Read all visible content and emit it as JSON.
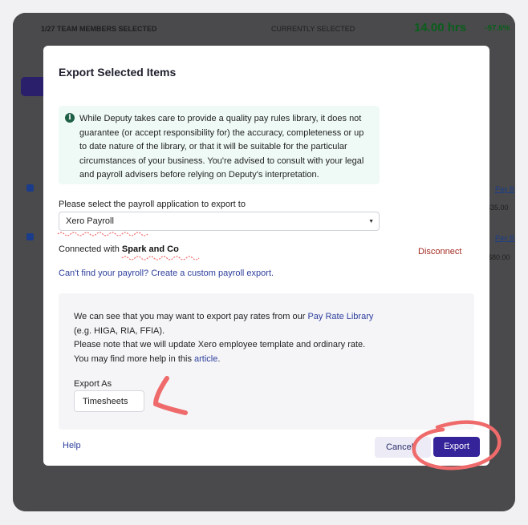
{
  "background": {
    "members_selected": "1/27 TEAM MEMBERS SELECTED",
    "currently_selected": "CURRENTLY SELECTED",
    "hours": "14.00 hrs",
    "percent": "-97.6%",
    "amount_1": "$35.00",
    "amount_2": "$80.00",
    "pay_link": "Pay B"
  },
  "modal": {
    "title": "Export Selected Items",
    "info_icon": "info-circle-icon",
    "info_text": "While Deputy takes care to provide a quality pay rules library, it does not guarantee (or accept responsibility for) the accuracy, completeness or up to date nature of the library, or that it will be suitable for the particular circumstances of your business. You're advised to consult with your legal and payroll advisers before relying on Deputy's interpretation.",
    "select_label": "Please select the payroll application to export to",
    "select_value": "Xero Payroll",
    "connected_prefix": "Connected with",
    "connected_org": "Spark and Co",
    "disconnect": "Disconnect",
    "custom_link": "Can't find your payroll? Create a custom payroll export.",
    "notice": {
      "line1_prefix": "We can see that you may want to export pay rates from our ",
      "line1_link": "Pay Rate Library",
      "line2": "(e.g. HIGA, RIA, FFIA).",
      "line3": "Please note that we will update Xero employee template and ordinary rate.",
      "line4_prefix": "You may find more help in this ",
      "line4_link": "article",
      "line4_suffix": "."
    },
    "export_as_label": "Export As",
    "export_as_value": "Timesheets",
    "help": "Help",
    "cancel": "Cancel",
    "export": "Export"
  },
  "colors": {
    "primary": "#35239a",
    "link": "#2d3e9b",
    "danger": "#a32b22",
    "annotation": "#ef6b6b",
    "info_bg": "#effaf6"
  }
}
